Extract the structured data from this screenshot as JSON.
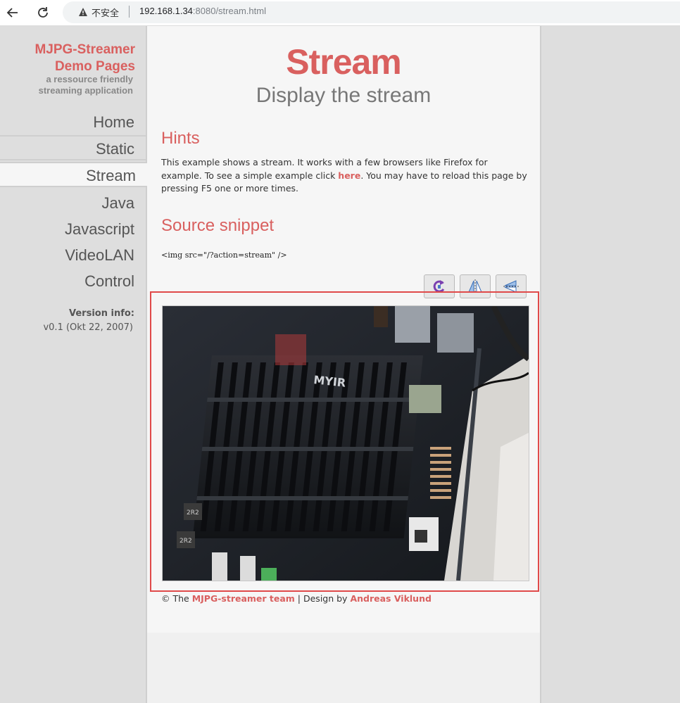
{
  "browser": {
    "security_label": "不安全",
    "url_host": "192.168.1.34",
    "url_rest": ":8080/stream.html"
  },
  "menu": {
    "site_title_1": "MJPG-Streamer",
    "site_title_2": "Demo Pages",
    "tagline_1": "a ressource friendly",
    "tagline_2": "streaming application",
    "items": [
      {
        "label": "Home"
      },
      {
        "label": "Static"
      },
      {
        "label": "Stream"
      },
      {
        "label": "Java"
      },
      {
        "label": "Javascript"
      },
      {
        "label": "VideoLAN"
      },
      {
        "label": "Control"
      }
    ],
    "active_item": "Stream",
    "version_label": "Version info:",
    "version_value": "v0.1 (Okt 22, 2007)"
  },
  "content": {
    "title": "Stream",
    "subtitle": "Display the stream",
    "hints_heading": "Hints",
    "hints_text_1": "This example shows a stream. It works with a few browsers like Firefox for example. To see a simple example click ",
    "hints_link": "here",
    "hints_text_2": ". You may have to reload this page by pressing F5 one or more times.",
    "snippet_heading": "Source snippet",
    "snippet_code": "<img src=\"/?action=stream\" />",
    "toolbar": [
      {
        "icon": "rotate-icon"
      },
      {
        "icon": "mirror-horizontal-icon"
      },
      {
        "icon": "mirror-vertical-icon"
      }
    ],
    "stream_board_label": "MYIR",
    "stream_chip_labels": [
      "2R2",
      "2R2"
    ]
  },
  "footer": {
    "prefix": "© The ",
    "team_link": "MJPG-streamer team",
    "middle": " | Design by ",
    "designer_link": "Andreas Viklund"
  },
  "colors": {
    "accent": "#d9605f",
    "highlight_border": "#e04a4a",
    "menu_bg": "#dedede",
    "content_bg": "#f6f6f6"
  }
}
